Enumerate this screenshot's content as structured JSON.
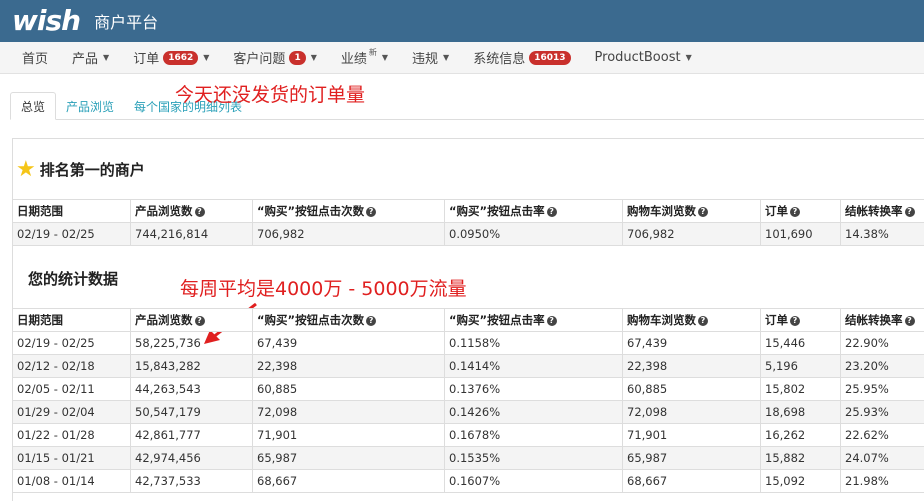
{
  "header": {
    "logo": "wish",
    "portal_title": "商户平台"
  },
  "nav": {
    "items": [
      {
        "label": "首页"
      },
      {
        "label": "产品",
        "caret": "▼"
      },
      {
        "label": "订单",
        "badge": "1662",
        "caret": "▼"
      },
      {
        "label": "客户问题",
        "badge": "1",
        "caret": "▼"
      },
      {
        "label": "业绩",
        "sup": "新",
        "caret": "▼"
      },
      {
        "label": "违规",
        "caret": "▼"
      },
      {
        "label": "系统信息",
        "badge": "16013"
      },
      {
        "label": "ProductBoost",
        "caret": "▼"
      }
    ]
  },
  "tabs": [
    {
      "label": "总览",
      "active": true
    },
    {
      "label": "产品浏览"
    },
    {
      "label": "每个国家的明细列表"
    }
  ],
  "annotations": {
    "unshipped": "今天还没发货的订单量",
    "weekly": "每周平均是4000万 - 5000万流量"
  },
  "top_merchant": {
    "title": "排名第一的商户",
    "headers": [
      "日期范围",
      "产品浏览数",
      "“购买”按钮点击次数",
      "“购买”按钮点击率",
      "购物车浏览数",
      "订单",
      "结帐转换率"
    ],
    "row": [
      "02/19 - 02/25",
      "744,216,814",
      "706,982",
      "0.0950%",
      "706,982",
      "101,690",
      "14.38%"
    ]
  },
  "your_stats": {
    "title": "您的统计数据",
    "headers": [
      "日期范围",
      "产品浏览数",
      "“购买”按钮点击次数",
      "“购买”按钮点击率",
      "购物车浏览数",
      "订单",
      "结帐转换率"
    ],
    "rows": [
      [
        "02/19 - 02/25",
        "58,225,736",
        "67,439",
        "0.1158%",
        "67,439",
        "15,446",
        "22.90%"
      ],
      [
        "02/12 - 02/18",
        "15,843,282",
        "22,398",
        "0.1414%",
        "22,398",
        "5,196",
        "23.20%"
      ],
      [
        "02/05 - 02/11",
        "44,263,543",
        "60,885",
        "0.1376%",
        "60,885",
        "15,802",
        "25.95%"
      ],
      [
        "01/29 - 02/04",
        "50,547,179",
        "72,098",
        "0.1426%",
        "72,098",
        "18,698",
        "25.93%"
      ],
      [
        "01/22 - 01/28",
        "42,861,777",
        "71,901",
        "0.1678%",
        "71,901",
        "16,262",
        "22.62%"
      ],
      [
        "01/15 - 01/21",
        "42,974,456",
        "65,987",
        "0.1535%",
        "65,987",
        "15,882",
        "24.07%"
      ],
      [
        "01/08 - 01/14",
        "42,737,533",
        "68,667",
        "0.1607%",
        "68,667",
        "15,092",
        "21.98%"
      ]
    ]
  }
}
